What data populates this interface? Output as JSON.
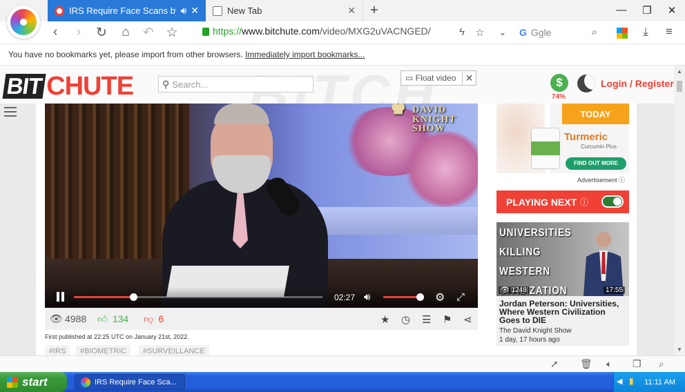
{
  "browser": {
    "tabs": [
      {
        "title": "IRS Require Face Scans by",
        "active": true
      },
      {
        "title": "New Tab",
        "active": false
      }
    ],
    "url": {
      "scheme": "https://",
      "domain": "www.bitchute.com",
      "path": "/video/MXG2uVACNGED/"
    },
    "search_engine_placeholder": "Ggle",
    "bookmarks_message": "You have no bookmarks yet, please import from other browsers.",
    "bookmarks_link": "Immediately import bookmarks..."
  },
  "site": {
    "logo_bit": "BIT",
    "logo_chute": "CHUTE",
    "search_placeholder": "Search...",
    "float_video_label": "Float video",
    "donate_percent": "74%",
    "login_label": "Login / Register"
  },
  "video": {
    "show_logo_line1": "DAVID",
    "show_logo_line2": "KNIGHT SHOW",
    "time": "02:27",
    "progress": 0.24,
    "volume": 0.95,
    "views": "4988",
    "likes": "134",
    "dislikes": "6",
    "published": "First published at 22:25 UTC on January 21st, 2022.",
    "tags": [
      "#IRS",
      "#BIOMETRIC",
      "#SURVEILLANCE"
    ]
  },
  "sidebar": {
    "ad_headline": "TODAY",
    "ad_brand": "Turmeric",
    "ad_sub": "Curcumin Plus",
    "ad_cta": "FIND OUT MORE",
    "ad_label": "Advertisement",
    "playing_next_label": "PLAYING NEXT",
    "next": {
      "thumb_lines": [
        "UNIVERSITIES",
        "KILLING",
        "WESTERN",
        "CIVILIZATION"
      ],
      "views": "1248",
      "duration": "17:55",
      "title": "Jordan Peterson: Universities, Where Western Civilization Goes to DIE",
      "channel": "The David Knight Show",
      "age": "1 day, 17 hours ago"
    }
  },
  "taskbar": {
    "start_label": "start",
    "window_title": "IRS Require Face Sca...",
    "clock": "11:11 AM"
  },
  "colors": {
    "brand_red": "#ef4136",
    "tab_blue": "#2979d9",
    "like_green": "#4caf50"
  }
}
